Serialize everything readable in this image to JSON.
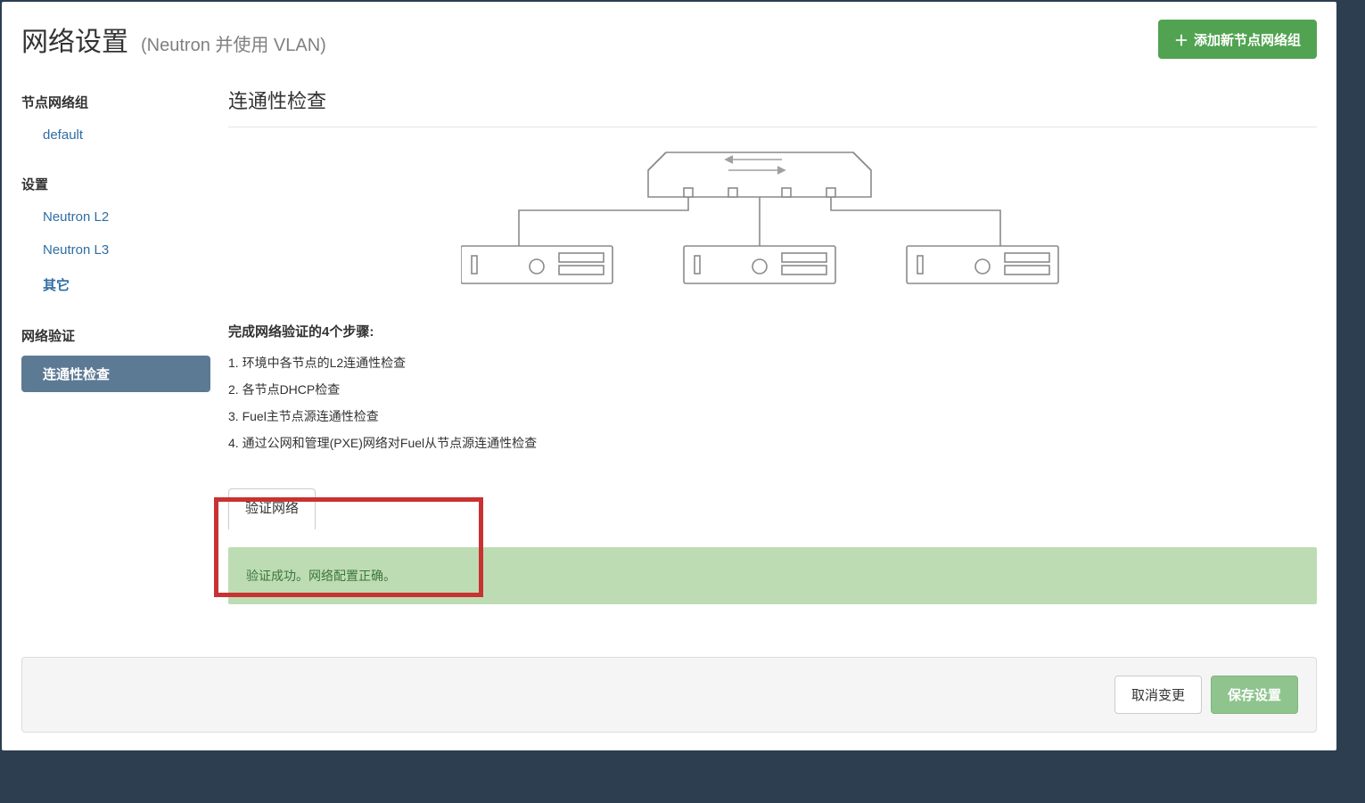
{
  "header": {
    "title": "网络设置",
    "subtitle": "(Neutron 并使用 VLAN)",
    "add_button": "添加新节点网络组"
  },
  "sidebar": {
    "group_nodes_title": "节点网络组",
    "items_nodes": [
      {
        "label": "default"
      }
    ],
    "group_settings_title": "设置",
    "items_settings": [
      {
        "label": "Neutron L2"
      },
      {
        "label": "Neutron L3"
      },
      {
        "label": "其它"
      }
    ],
    "group_verify_title": "网络验证",
    "items_verify": [
      {
        "label": "连通性检查"
      }
    ]
  },
  "main": {
    "section_title": "连通性检查",
    "steps_title": "完成网络验证的4个步骤:",
    "steps": [
      "1. 环境中各节点的L2连通性检查",
      "2. 各节点DHCP检查",
      "3. Fuel主节点源连通性检查",
      "4. 通过公网和管理(PXE)网络对Fuel从节点源连通性检查"
    ],
    "verify_button": "验证网络",
    "success_msg": "验证成功。网络配置正确。"
  },
  "footer": {
    "cancel": "取消变更",
    "save": "保存设置"
  }
}
